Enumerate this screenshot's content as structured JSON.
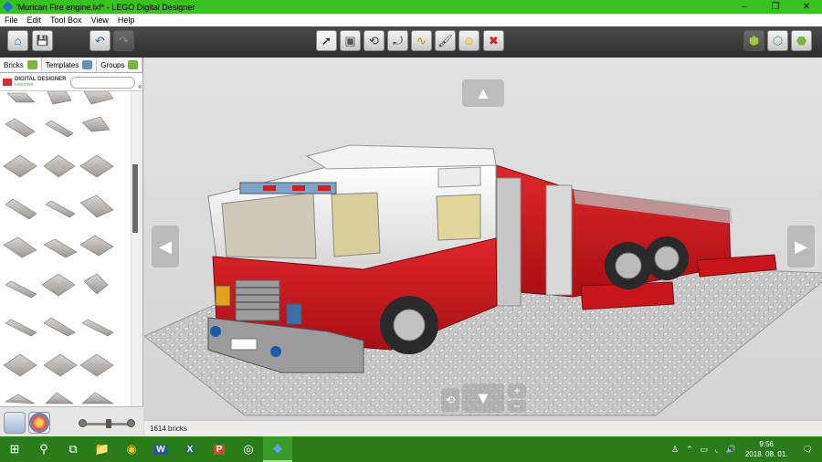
{
  "window": {
    "title": "'Murican Fire engine.lxf* - LEGO Digital Designer",
    "controls": [
      "–",
      "❐",
      "✕"
    ]
  },
  "menu": [
    "File",
    "Edit",
    "Tool Box",
    "View",
    "Help"
  ],
  "toolbar": {
    "left": [
      {
        "name": "home-button",
        "icon": "⌂"
      },
      {
        "name": "save-button",
        "icon": "💾"
      },
      {
        "name": "undo-button",
        "icon": "↶"
      },
      {
        "name": "redo-button",
        "icon": "↷"
      }
    ],
    "center": [
      {
        "name": "select-tool",
        "icon": "➚"
      },
      {
        "name": "clone-tool",
        "icon": "▣"
      },
      {
        "name": "hinge-tool",
        "icon": "⟲"
      },
      {
        "name": "hinge-align-tool",
        "icon": "⤾"
      },
      {
        "name": "flex-tool",
        "icon": "∿"
      },
      {
        "name": "paint-tool",
        "icon": "🖌"
      },
      {
        "name": "decoration-tool",
        "icon": "☺"
      },
      {
        "name": "delete-tool",
        "icon": "✖"
      }
    ],
    "right": [
      {
        "name": "build-mode",
        "icon": "⬢"
      },
      {
        "name": "view-mode",
        "icon": "⬡"
      },
      {
        "name": "instructions-mode",
        "icon": "⬣"
      }
    ]
  },
  "tabs": [
    {
      "label": "Bricks",
      "selected": true
    },
    {
      "label": "Templates",
      "selected": false
    },
    {
      "label": "Groups",
      "selected": false
    }
  ],
  "brand": {
    "name": "DIGITAL DESIGNER",
    "sub": "extended"
  },
  "search": {
    "value": ""
  },
  "status": {
    "brick_count": "1614 bricks"
  },
  "taskbar": {
    "items": [
      "⊞",
      "⚲",
      "⧉",
      "📁",
      "◉",
      "W",
      "X",
      "P",
      "◎",
      "◆"
    ],
    "tray": [
      "♙",
      "⌃",
      "▭",
      "◟",
      "🔊"
    ],
    "time": "9:56",
    "date": "2018. 08. 01."
  },
  "colors": {
    "titlebar": "#39c21f",
    "taskbar": "#2a7b1a",
    "truck_red": "#c8141b"
  }
}
